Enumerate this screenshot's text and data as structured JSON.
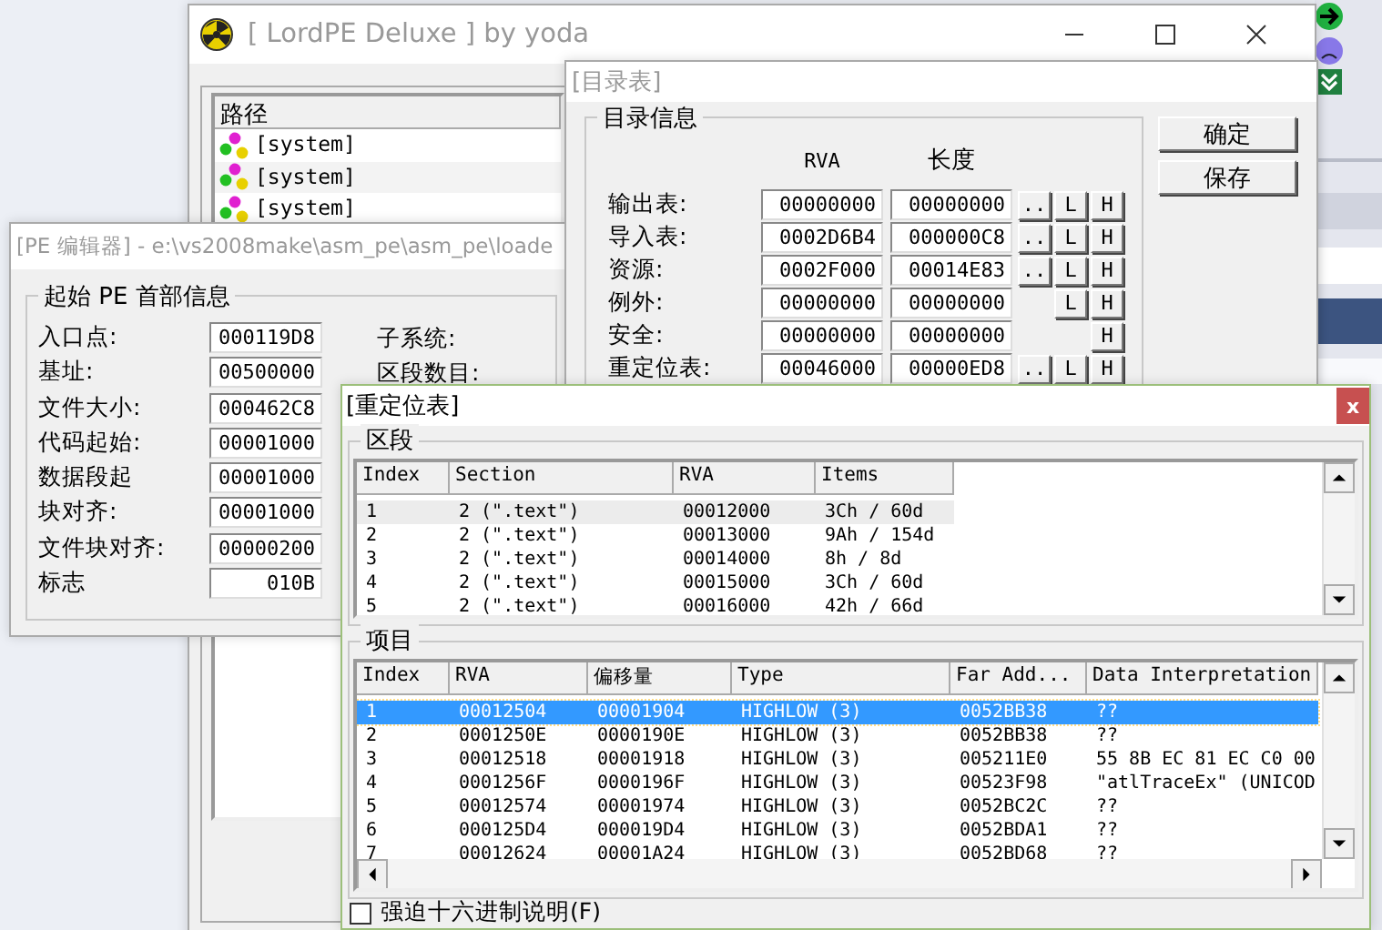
{
  "lordpe": {
    "title": "[ LordPE Deluxe ] by yoda",
    "list": {
      "columns": [
        "路径"
      ],
      "rows": [
        "[system]",
        "[system]",
        "[system]"
      ]
    }
  },
  "pe_editor": {
    "title": "[PE 编辑器] - e:\\vs2008make\\asm_pe\\asm_pe\\loade",
    "group": "起始 PE 首部信息",
    "fields": [
      {
        "label": "入口点:",
        "value": "000119D8"
      },
      {
        "label": "基址:",
        "value": "00500000"
      },
      {
        "label": "文件大小:",
        "value": "000462C8"
      },
      {
        "label": "代码起始:",
        "value": "00001000"
      },
      {
        "label": "数据段起",
        "value": "00001000"
      },
      {
        "label": "块对齐:",
        "value": "00001000"
      },
      {
        "label": "文件块对齐:",
        "value": "00000200"
      },
      {
        "label": "标志",
        "value": "010B"
      }
    ],
    "side_labels": [
      "子系统:",
      "区段数目:"
    ]
  },
  "directory": {
    "title": "[目录表]",
    "group": "目录信息",
    "columns": [
      "RVA",
      "长度"
    ],
    "rows": [
      {
        "label": "输出表:",
        "rva": "00000000",
        "size": "00000000",
        "buttons": [
          "..",
          "L",
          "H"
        ]
      },
      {
        "label": "导入表:",
        "rva": "0002D6B4",
        "size": "000000C8",
        "buttons": [
          "..",
          "L",
          "H"
        ]
      },
      {
        "label": "资源:",
        "rva": "0002F000",
        "size": "00014E83",
        "buttons": [
          "..",
          "L",
          "H"
        ]
      },
      {
        "label": "例外:",
        "rva": "00000000",
        "size": "00000000",
        "buttons": [
          "L",
          "H"
        ]
      },
      {
        "label": "安全:",
        "rva": "00000000",
        "size": "00000000",
        "buttons": [
          "H"
        ]
      },
      {
        "label": "重定位表:",
        "rva": "00046000",
        "size": "00000ED8",
        "buttons": [
          "..",
          "L",
          "H"
        ]
      }
    ],
    "buttons": [
      "确定",
      "保存"
    ]
  },
  "relocation": {
    "title": "[重定位表]",
    "close": "x",
    "sections": {
      "group": "区段",
      "columns": [
        "Index",
        "Section",
        "RVA",
        "Items"
      ],
      "rows": [
        {
          "cells": [
            "1",
            "2 (\".text\")",
            "00012000",
            "3Ch / 60d"
          ],
          "selected": true
        },
        {
          "cells": [
            "2",
            "2 (\".text\")",
            "00013000",
            "9Ah / 154d"
          ],
          "selected": false
        },
        {
          "cells": [
            "3",
            "2 (\".text\")",
            "00014000",
            "8h / 8d"
          ],
          "selected": false
        },
        {
          "cells": [
            "4",
            "2 (\".text\")",
            "00015000",
            "3Ch / 60d"
          ],
          "selected": false
        },
        {
          "cells": [
            "5",
            "2 (\".text\")",
            "00016000",
            "42h / 66d"
          ],
          "selected": false
        }
      ]
    },
    "items": {
      "group": "项目",
      "columns": [
        "Index",
        "RVA",
        "偏移量",
        "Type",
        "Far Add...",
        "Data Interpretation"
      ],
      "rows": [
        {
          "cells": [
            "1",
            "00012504",
            "00001904",
            "HIGHLOW (3)",
            "0052BB38",
            "??"
          ],
          "selected": true
        },
        {
          "cells": [
            "2",
            "0001250E",
            "0000190E",
            "HIGHLOW (3)",
            "0052BB38",
            "??"
          ],
          "selected": false
        },
        {
          "cells": [
            "3",
            "00012518",
            "00001918",
            "HIGHLOW (3)",
            "005211E0",
            "55 8B EC 81 EC C0 00"
          ],
          "selected": false
        },
        {
          "cells": [
            "4",
            "0001256F",
            "0000196F",
            "HIGHLOW (3)",
            "00523F98",
            "\"atlTraceEx\" (UNICOD"
          ],
          "selected": false
        },
        {
          "cells": [
            "5",
            "00012574",
            "00001974",
            "HIGHLOW (3)",
            "0052BC2C",
            "??"
          ],
          "selected": false
        },
        {
          "cells": [
            "6",
            "000125D4",
            "000019D4",
            "HIGHLOW (3)",
            "0052BDA1",
            "??"
          ],
          "selected": false
        },
        {
          "cells": [
            "7",
            "00012624",
            "00001A24",
            "HIGHLOW (3)",
            "0052BD68",
            "??"
          ],
          "selected": false
        }
      ]
    },
    "checkbox": {
      "label": "强迫十六进制说明(F)",
      "checked": false
    }
  }
}
